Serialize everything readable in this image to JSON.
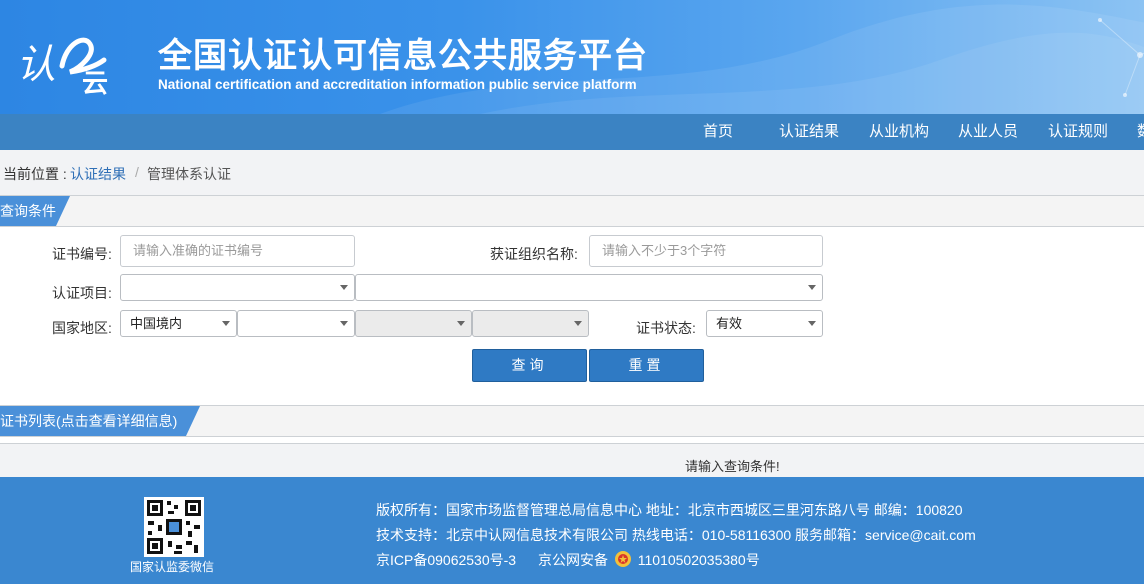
{
  "header": {
    "logo_text": "认云",
    "title": "全国认证认可信息公共服务平台",
    "subtitle": "National certification and accreditation information public service platform"
  },
  "nav": {
    "items": [
      {
        "label": "首页"
      },
      {
        "label": "认证结果"
      },
      {
        "label": "从业机构"
      },
      {
        "label": "从业人员"
      },
      {
        "label": "认证规则"
      },
      {
        "label": "数"
      }
    ]
  },
  "breadcrumb": {
    "prefix": "当前位置 :",
    "link": "认证结果",
    "separator": "/",
    "current": "管理体系认证"
  },
  "query_section": {
    "title": "查询条件"
  },
  "form": {
    "cert_no_label": "证书编号:",
    "cert_no_placeholder": "请输入准确的证书编号",
    "org_name_label": "获证组织名称:",
    "org_name_placeholder": "请输入不少于3个字符",
    "project_label": "认证项目:",
    "project_value_1": "",
    "project_value_2": "",
    "region_label": "国家地区:",
    "region_value_1": "中国境内",
    "region_value_2": "",
    "region_value_3": "",
    "region_value_4": "",
    "status_label": "证书状态:",
    "status_value": "有效",
    "search_button": "查询",
    "reset_button": "重置"
  },
  "list_section": {
    "title": "证书列表(点击查看详细信息)"
  },
  "result": {
    "message": "请输入查询条件!"
  },
  "footer": {
    "qr_label": "国家认监委微信",
    "line1": "版权所有：国家市场监督管理总局信息中心   地址：北京市西城区三里河东路八号   邮编：100820",
    "line2": "技术支持：北京中认网信息技术有限公司   热线电话：010-58116300   服务邮箱：service@cait.com",
    "line3a": "京ICP备09062530号-3",
    "line3b": "京公网安备",
    "line3c": "11010502035380号"
  },
  "colors": {
    "header_blue": "#2d86e3",
    "nav_blue": "#3b83c3",
    "button_blue": "#2f7ac4",
    "footer_blue": "#3a87d0",
    "link_blue": "#2f6fb6"
  }
}
